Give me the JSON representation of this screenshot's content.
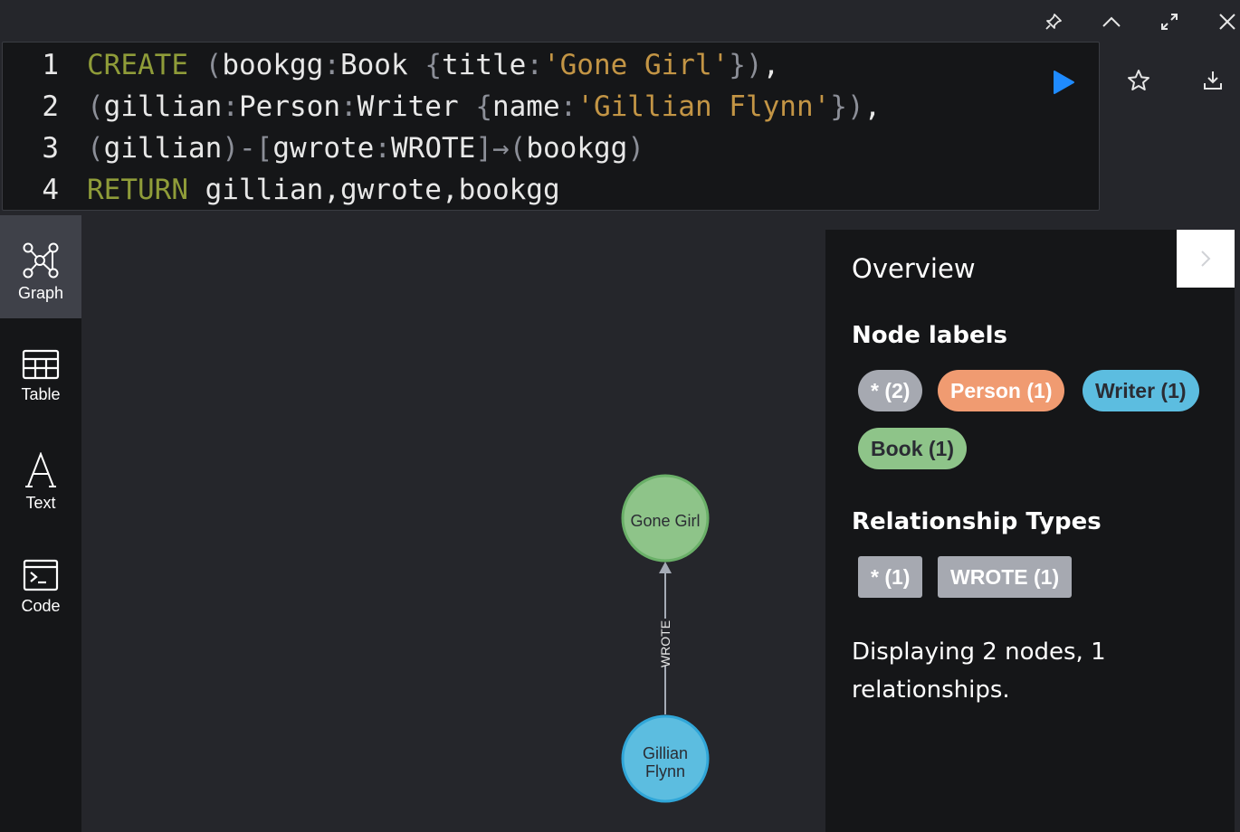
{
  "editor": {
    "line_numbers": [
      "1",
      "2",
      "3",
      "4"
    ],
    "lines": [
      [
        {
          "t": "CREATE",
          "c": "kw"
        },
        {
          "t": " ",
          "c": "id"
        },
        {
          "t": "(",
          "c": "pu"
        },
        {
          "t": "bookgg",
          "c": "id"
        },
        {
          "t": ":",
          "c": "pu"
        },
        {
          "t": "Book",
          "c": "id"
        },
        {
          "t": " ",
          "c": "id"
        },
        {
          "t": "{",
          "c": "pu"
        },
        {
          "t": "title",
          "c": "id"
        },
        {
          "t": ":",
          "c": "pu"
        },
        {
          "t": "'Gone Girl'",
          "c": "str"
        },
        {
          "t": "}",
          "c": "pu"
        },
        {
          "t": ")",
          "c": "pu"
        },
        {
          "t": ",",
          "c": "id"
        }
      ],
      [
        {
          "t": "(",
          "c": "pu"
        },
        {
          "t": "gillian",
          "c": "id"
        },
        {
          "t": ":",
          "c": "pu"
        },
        {
          "t": "Person",
          "c": "id"
        },
        {
          "t": ":",
          "c": "pu"
        },
        {
          "t": "Writer",
          "c": "id"
        },
        {
          "t": " ",
          "c": "id"
        },
        {
          "t": "{",
          "c": "pu"
        },
        {
          "t": "name",
          "c": "id"
        },
        {
          "t": ":",
          "c": "pu"
        },
        {
          "t": "'Gillian Flynn'",
          "c": "str"
        },
        {
          "t": "}",
          "c": "pu"
        },
        {
          "t": ")",
          "c": "pu"
        },
        {
          "t": ",",
          "c": "id"
        }
      ],
      [
        {
          "t": "(",
          "c": "pu"
        },
        {
          "t": "gillian",
          "c": "id"
        },
        {
          "t": ")",
          "c": "pu"
        },
        {
          "t": "-",
          "c": "pu"
        },
        {
          "t": "[",
          "c": "pu"
        },
        {
          "t": "gwrote",
          "c": "id"
        },
        {
          "t": ":",
          "c": "pu"
        },
        {
          "t": "WROTE",
          "c": "id"
        },
        {
          "t": "]",
          "c": "pu"
        },
        {
          "t": "→",
          "c": "pu"
        },
        {
          "t": "(",
          "c": "pu"
        },
        {
          "t": "bookgg",
          "c": "id"
        },
        {
          "t": ")",
          "c": "pu"
        }
      ],
      [
        {
          "t": "RETURN",
          "c": "kw"
        },
        {
          "t": " gillian",
          "c": "id"
        },
        {
          "t": ",",
          "c": "id"
        },
        {
          "t": "gwrote",
          "c": "id"
        },
        {
          "t": ",",
          "c": "id"
        },
        {
          "t": "bookgg",
          "c": "id"
        }
      ]
    ]
  },
  "nav": {
    "items": [
      {
        "label": "Graph",
        "icon": "graph-icon",
        "active": true
      },
      {
        "label": "Table",
        "icon": "table-icon",
        "active": false
      },
      {
        "label": "Text",
        "icon": "text-icon",
        "active": false
      },
      {
        "label": "Code",
        "icon": "code-icon",
        "active": false
      }
    ]
  },
  "graph": {
    "nodes": [
      {
        "label": "Gone Girl",
        "color": "#8ec489",
        "border": "#6ab068"
      },
      {
        "label_lines": [
          "Gillian",
          "Flynn"
        ],
        "color": "#5cbde0",
        "border": "#30a6d8"
      }
    ],
    "relationship": {
      "label": "WROTE"
    }
  },
  "overview": {
    "title": "Overview",
    "node_labels_heading": "Node labels",
    "node_labels": [
      {
        "text": "* (2)",
        "bg": "#a6a9b1",
        "fg": "#ffffff"
      },
      {
        "text": "Person (1)",
        "bg": "#f09b71",
        "fg": "#ffffff"
      },
      {
        "text": "Writer (1)",
        "bg": "#5cbde0",
        "fg": "#2a2c33"
      },
      {
        "text": "Book (1)",
        "bg": "#8ec489",
        "fg": "#2a2c33"
      }
    ],
    "rel_types_heading": "Relationship Types",
    "rel_types": [
      {
        "text": "* (1)"
      },
      {
        "text": "WROTE (1)"
      }
    ],
    "status": "Displaying 2 nodes, 1 relationships."
  },
  "colors": {
    "accent_run": "#1f8bff",
    "background": "#25262b",
    "panel": "#151618"
  }
}
